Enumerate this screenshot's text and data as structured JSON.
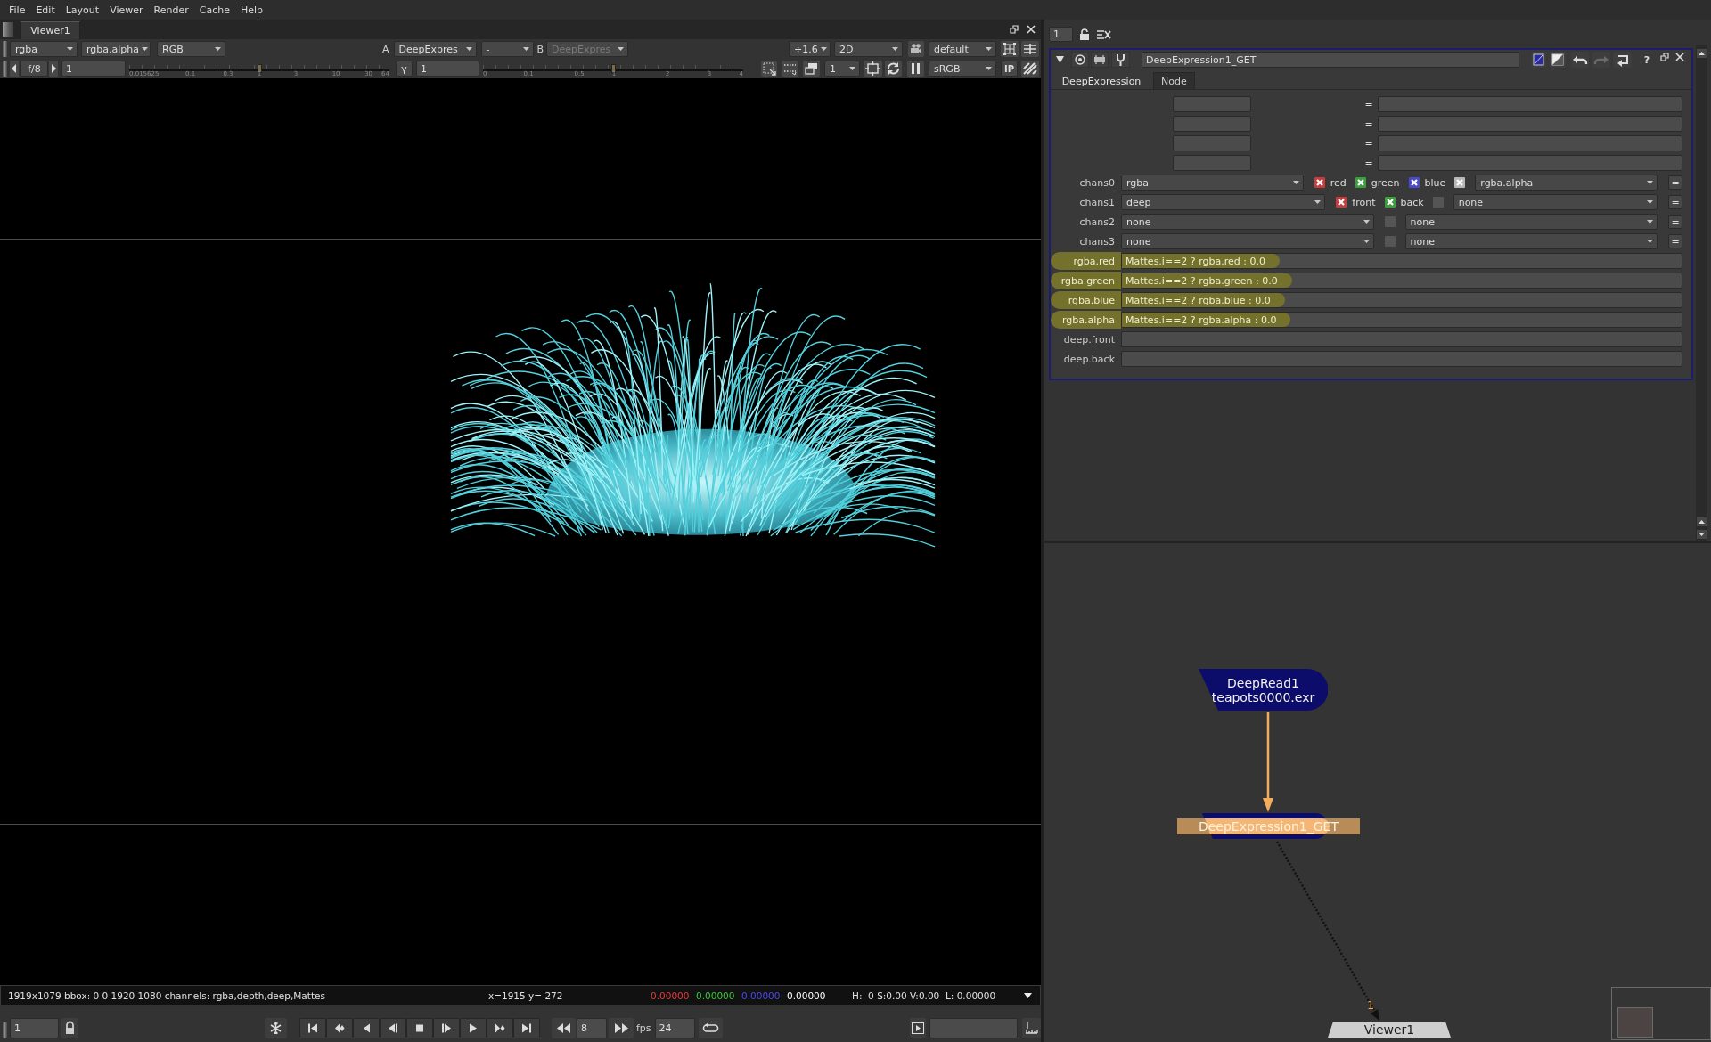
{
  "menu_bar": [
    {
      "label": "File"
    },
    {
      "label": "Edit"
    },
    {
      "label": "Layout"
    },
    {
      "label": "Viewer"
    },
    {
      "label": "Render"
    },
    {
      "label": "Cache"
    },
    {
      "label": "Help"
    }
  ],
  "viewer": {
    "tab": {
      "label": "Viewer1",
      "selected": true
    },
    "toolbar": {
      "channels": "rgba",
      "alpha_channel": "rgba.alpha",
      "display": "RGB",
      "input_a": {
        "label": "A",
        "value": "DeepExpres"
      },
      "wipe": "-",
      "input_b": {
        "label": "B",
        "value": "DeepExpres",
        "disabled": true
      },
      "zoom": "÷1.6",
      "view": "2D",
      "lut": "default"
    },
    "controls": {
      "f_stop": "f/8",
      "gain": {
        "value": "1",
        "level": 0.5,
        "ticks": [
          "0.015625",
          "0.1",
          "0.3",
          "1",
          "3",
          "10",
          "30",
          "64"
        ]
      },
      "gamma": {
        "label": "γ",
        "value": "1",
        "level": 0.5,
        "ticks": [
          "0",
          "0.1",
          "0.5",
          "1",
          "2",
          "3",
          "4"
        ]
      },
      "proxy": "1",
      "colorspace": "sRGB",
      "input_process": "IP"
    },
    "status_bar": {
      "info": "1919x1079 bbox: 0 0 1920 1080 channels: rgba,depth,deep,Mattes",
      "position": "x=1915 y= 272",
      "pixel": [
        {
          "value": "0.00000",
          "color": "#e03c3c"
        },
        {
          "value": "0.00000",
          "color": "#3cc83c"
        },
        {
          "value": "0.00000",
          "color": "#4a4ae6"
        },
        {
          "value": "0.00000",
          "color": "#ffffff"
        }
      ],
      "hsvl": "H:  0 S:0.00 V:0.00  L: 0.00000"
    },
    "playback": {
      "frame": "1",
      "increment": "8",
      "fps_label": "fps",
      "fps": "24"
    }
  },
  "properties": {
    "panel_limit": "1",
    "node_name": "DeepExpression1_GET",
    "help": "?",
    "tabs": [
      {
        "label": "DeepExpression",
        "selected": true
      },
      {
        "label": "Node",
        "selected": false
      }
    ],
    "variable_rows": [
      {
        "operator": "="
      },
      {
        "operator": "="
      },
      {
        "operator": "="
      },
      {
        "operator": "="
      }
    ],
    "channel_rows": [
      {
        "label": "chans0",
        "channel_set": "rgba",
        "components": [
          {
            "label": "red",
            "checked": true,
            "color": "#c83c3c"
          },
          {
            "label": "green",
            "checked": true,
            "color": "#3c9e3c"
          },
          {
            "label": "blue",
            "checked": true,
            "color": "#4a4acc"
          },
          {
            "checked": true,
            "color": "#b8b8b8"
          }
        ],
        "channel": "rgba.alpha",
        "link": "="
      },
      {
        "label": "chans1",
        "channel_set": "deep",
        "components": [
          {
            "label": "front",
            "checked": true,
            "color": "#c83c3c"
          },
          {
            "label": "back",
            "checked": true,
            "color": "#3c9e3c"
          },
          {
            "checked": false
          }
        ],
        "channel": "none",
        "link": "="
      },
      {
        "label": "chans2",
        "channel_set": "none",
        "components": [
          {
            "checked": false
          }
        ],
        "channel": "none",
        "link": "="
      },
      {
        "label": "chans3",
        "channel_set": "none",
        "components": [
          {
            "checked": false
          }
        ],
        "channel": "none",
        "link": "="
      }
    ],
    "expression_rows": [
      {
        "label": "rgba.red",
        "expression": "Mattes.i==2 ? rgba.red : 0.0",
        "highlighted": true
      },
      {
        "label": "rgba.green",
        "expression": "Mattes.i==2 ? rgba.green : 0.0",
        "highlighted": true
      },
      {
        "label": "rgba.blue",
        "expression": "Mattes.i==2 ? rgba.blue : 0.0",
        "highlighted": true
      },
      {
        "label": "rgba.alpha",
        "expression": "Mattes.i==2 ? rgba.alpha : 0.0",
        "highlighted": true
      },
      {
        "label": "deep.front",
        "highlighted": false
      },
      {
        "label": "deep.back",
        "highlighted": false
      }
    ]
  },
  "node_graph": {
    "nodes": [
      {
        "kind": "read",
        "name": "DeepRead1",
        "file": "teapots0000.exr"
      },
      {
        "kind": "expression",
        "label": "DeepExpression1_GET",
        "selected": true
      },
      {
        "kind": "viewer",
        "label": "Viewer1"
      }
    ],
    "connections": [
      {
        "kind": "pipe"
      },
      {
        "kind": "dotted",
        "input": "1"
      }
    ]
  }
}
